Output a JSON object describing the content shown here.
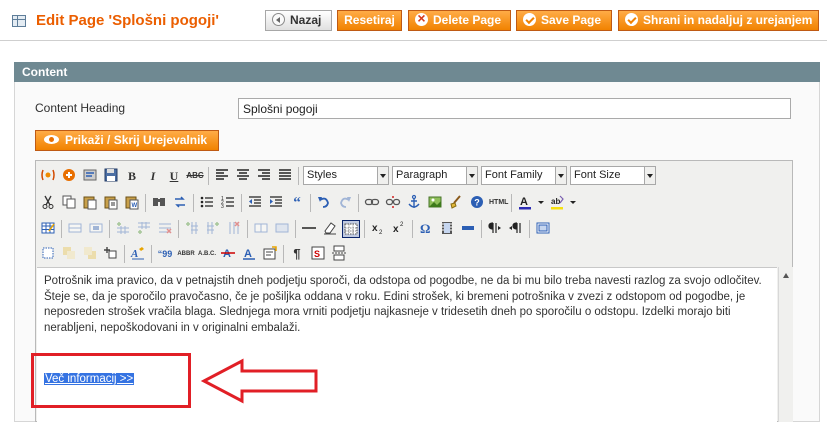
{
  "header": {
    "title": "Edit Page 'Splošni pogoji'",
    "buttons": {
      "back": "Nazaj",
      "reset": "Resetiraj",
      "delete": "Delete Page",
      "save": "Save Page",
      "save_continue": "Shrani in nadaljuj z urejanjem"
    }
  },
  "section": {
    "title": "Content",
    "heading_label": "Content Heading",
    "heading_value": "Splošni pogoji",
    "toggle_editor": "Prikaži / Skrij Urejevalnik"
  },
  "toolbar": {
    "styles": "Styles",
    "format": "Paragraph",
    "font_family": "Font Family",
    "font_size": "Font Size"
  },
  "content": {
    "paragraph": "Potrošnik ima pravico, da v petnajstih dneh podjetju sporoči, da odstopa od pogodbe, ne da bi mu bilo treba navesti razlog za svojo odločitev. Šteje se, da je sporočilo pravočasno, če je pošiljka oddana v roku. Edini strošek, ki bremeni potrošnika v zvezi z odstopom od pogodbe, je neposreden strošek vračila blaga. Slednjega mora vrniti podjetju najkasneje v tridesetih dneh po sporočilu o odstopu. Izdelki morajo biti nerabljeni, nepoškodovani in v originalni embalaži.",
    "link": "Več informacij >>"
  },
  "colors": {
    "accent": "#eb5e00",
    "section_header": "#6f8992",
    "annotation": "#e11f26",
    "selection": "#3573e2"
  }
}
